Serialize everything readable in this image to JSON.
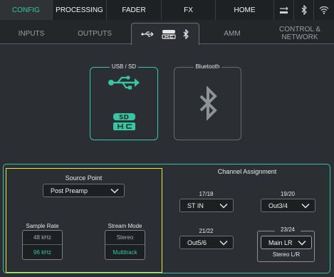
{
  "top_nav": {
    "items": [
      "CONFIG",
      "PROCESSING",
      "FADER",
      "FX",
      "HOME"
    ],
    "active": "CONFIG",
    "status_icons": [
      "usb-icon",
      "bluetooth-icon",
      "wifi-icon"
    ]
  },
  "tabs": {
    "inputs": "INPUTS",
    "outputs": "OUTPUTS",
    "amm": "AMM",
    "control_line1": "CONTROL &",
    "control_line2": "NETWORK"
  },
  "devices": {
    "usb_sd_label": "USB / SD",
    "bluetooth_label": "Bluetooth"
  },
  "source": {
    "title": "Source Point",
    "value": "Post Preamp"
  },
  "sample_rate": {
    "title": "Sample Rate",
    "options": [
      "48 kHz",
      "96 kHz"
    ],
    "selected": "96 kHz"
  },
  "stream_mode": {
    "title": "Stream Mode",
    "options": [
      "Stereo",
      "Multitrack"
    ],
    "selected": "Multitrack"
  },
  "channel_assignment": {
    "title": "Channel Assignment",
    "slots": [
      {
        "label": "17/18",
        "value": "ST IN"
      },
      {
        "label": "19/20",
        "value": "Out3/4"
      },
      {
        "label": "21/22",
        "value": "Out5/6"
      },
      {
        "label": "23/24",
        "value": "Main LR",
        "note": "Stereo L/R"
      }
    ]
  },
  "colors": {
    "accent": "#36c7a2",
    "highlight": "#e8e83a",
    "background": "#2b2f33"
  }
}
